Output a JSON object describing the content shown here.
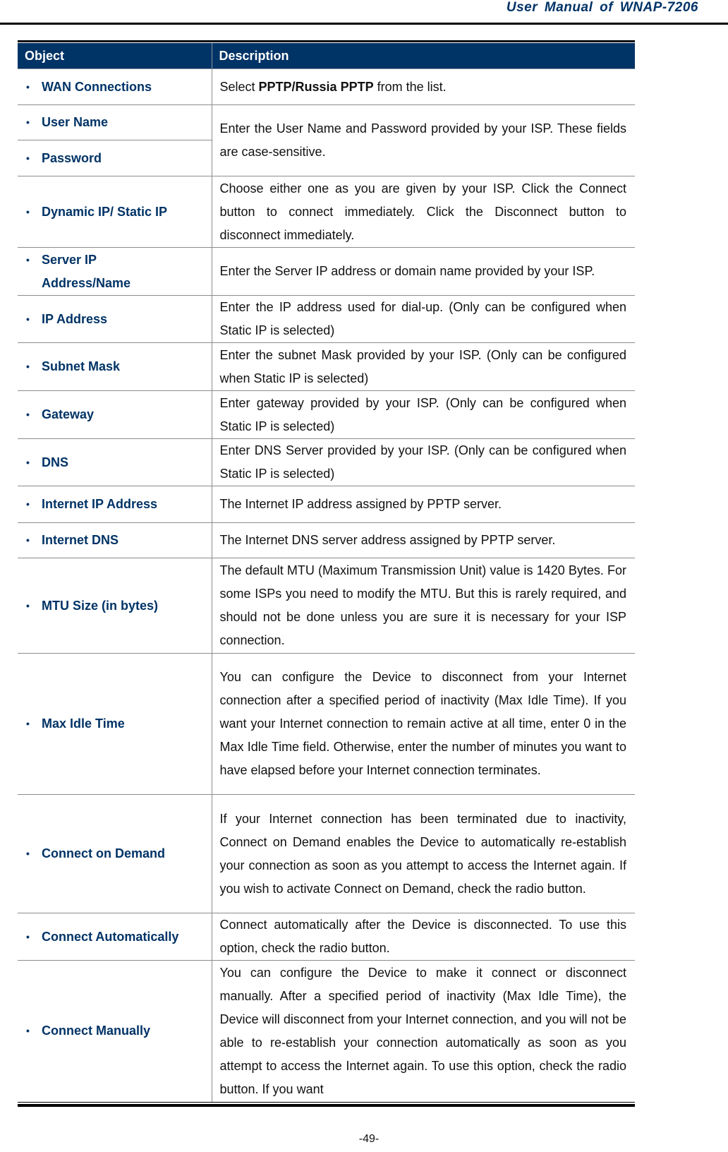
{
  "header": {
    "title": "User  Manual  of  WNAP-7206"
  },
  "table": {
    "columns": [
      "Object",
      "Description"
    ],
    "rows": [
      {
        "object": "WAN Connections",
        "desc_pre": "Select ",
        "desc_bold": "PPTP/Russia PPTP",
        "desc_post": " from the list."
      },
      {
        "object": "User Name",
        "desc": "Enter the User Name and Password provided by your ISP. These fields are case-sensitive."
      },
      {
        "object": "Password"
      },
      {
        "object": "Dynamic IP/ Static IP",
        "desc": "Choose either one as you are given by your ISP. Click the Connect button to connect immediately. Click the Disconnect button to disconnect immediately."
      },
      {
        "object": "Server IP Address/Name",
        "desc": "Enter the Server IP address or domain name provided by your ISP."
      },
      {
        "object": "IP Address",
        "desc": "Enter the IP address used for dial-up. (Only can be configured when Static IP is selected)"
      },
      {
        "object": "Subnet Mask",
        "desc": "Enter the subnet Mask provided by your ISP. (Only can be configured when Static IP is selected)"
      },
      {
        "object": "Gateway",
        "desc": "Enter gateway provided by your ISP. (Only can be configured when Static IP is selected)"
      },
      {
        "object": "DNS",
        "desc": "Enter DNS Server provided by your ISP. (Only can be configured when Static IP is selected)"
      },
      {
        "object": "Internet IP Address",
        "desc": "The Internet IP address assigned by PPTP server."
      },
      {
        "object": "Internet DNS",
        "desc": "The Internet DNS server address assigned by PPTP server."
      },
      {
        "object": "MTU Size (in bytes)",
        "desc": "The default MTU (Maximum Transmission Unit) value is 1420 Bytes. For some ISPs you need to modify the MTU. But this is rarely required, and should not be done unless you are sure it is necessary for your ISP connection."
      },
      {
        "object": "Max Idle Time",
        "desc": "You can configure the Device to disconnect from your Internet connection after a specified period of inactivity (Max Idle Time). If you want your Internet connection to remain active at all time, enter 0 in the Max Idle Time field. Otherwise, enter the number of minutes you want to have elapsed before your Internet connection terminates."
      },
      {
        "object": "Connect on Demand",
        "desc": "If your Internet connection has been terminated due to inactivity, Connect on Demand enables the Device to automatically re-establish your connection as soon as you attempt to access the Internet again. If you wish to activate Connect on Demand, check the radio button."
      },
      {
        "object": "Connect Automatically",
        "desc": "Connect automatically after the Device is disconnected. To use this option, check the radio button."
      },
      {
        "object": "Connect Manually",
        "desc": "You can configure the Device to make it connect or disconnect manually. After a specified period of inactivity (Max Idle Time), the Device will disconnect from your Internet connection, and you will not be able to re-establish your connection automatically as soon as you attempt to access the Internet again. To use this option, check the radio button. If you want"
      }
    ],
    "bullet": "•"
  },
  "footer": {
    "page_number": "-49-"
  }
}
